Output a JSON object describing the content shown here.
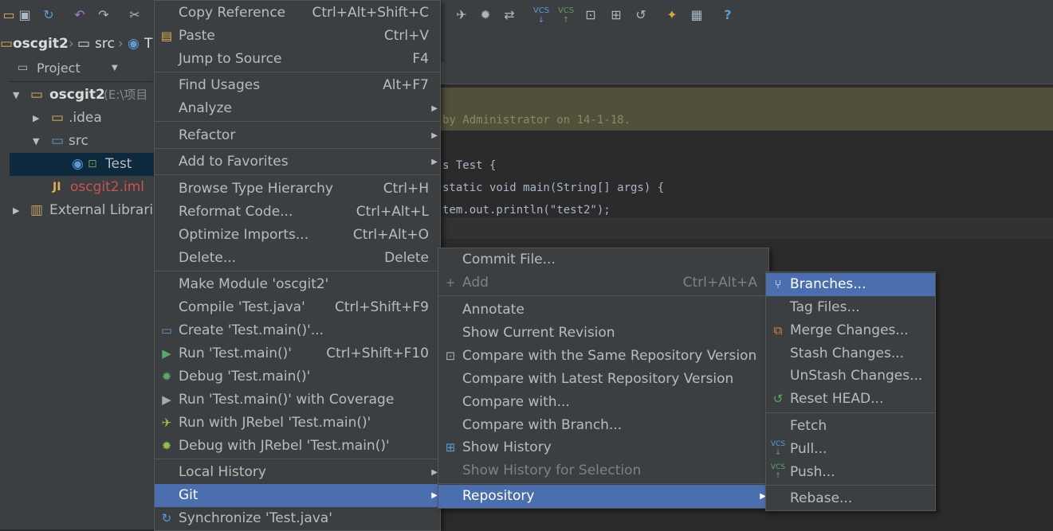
{
  "toolbar": {
    "icons": [
      "open-icon",
      "save-icon",
      "sync-icon",
      "undo-icon",
      "redo-icon",
      "cut-icon",
      "jrebel-run-icon",
      "jrebel-debug-icon",
      "vcs-update-icon",
      "vcs-update-project-icon",
      "vcs-commit-icon",
      "vcs-compare-icon",
      "vcs-history-icon",
      "vcs-revert-icon",
      "settings-icon",
      "structure-icon",
      "help-icon"
    ],
    "vcs_label": "VCS",
    "help_label": "?"
  },
  "breadcrumb": {
    "project": "oscgit2",
    "folder": "src",
    "file": "T"
  },
  "project_panel": {
    "header": "Project",
    "rows": [
      {
        "label": "oscgit2",
        "suffix": "(E:\\项目"
      },
      {
        "label": ".idea"
      },
      {
        "label": "src"
      },
      {
        "label": "Test"
      },
      {
        "label": "oscgit2.iml"
      },
      {
        "label": "External Librarie"
      }
    ]
  },
  "editor": {
    "comment": "by Administrator on 14-1-18.",
    "line1": "s Test {",
    "line2": "static void main(String[] args) {",
    "line3": "tem.out.println(\"test2\");"
  },
  "context_menu": {
    "items": [
      {
        "label": "Copy Reference",
        "shortcut": "Ctrl+Alt+Shift+C"
      },
      {
        "label": "Paste",
        "shortcut": "Ctrl+V"
      },
      {
        "label": "Jump to Source",
        "shortcut": "F4"
      },
      {
        "label": "Find Usages",
        "shortcut": "Alt+F7"
      },
      {
        "label": "Analyze"
      },
      {
        "label": "Refactor"
      },
      {
        "label": "Add to Favorites"
      },
      {
        "label": "Browse Type Hierarchy",
        "shortcut": "Ctrl+H"
      },
      {
        "label": "Reformat Code...",
        "shortcut": "Ctrl+Alt+L"
      },
      {
        "label": "Optimize Imports...",
        "shortcut": "Ctrl+Alt+O"
      },
      {
        "label": "Delete...",
        "shortcut": "Delete"
      },
      {
        "label": "Make Module 'oscgit2'"
      },
      {
        "label": "Compile 'Test.java'",
        "shortcut": "Ctrl+Shift+F9"
      },
      {
        "label": "Create 'Test.main()'..."
      },
      {
        "label": "Run 'Test.main()'",
        "shortcut": "Ctrl+Shift+F10"
      },
      {
        "label": "Debug 'Test.main()'"
      },
      {
        "label": "Run 'Test.main()' with Coverage"
      },
      {
        "label": "Run with JRebel 'Test.main()'"
      },
      {
        "label": "Debug with JRebel 'Test.main()'"
      },
      {
        "label": "Local History"
      },
      {
        "label": "Git"
      },
      {
        "label": "Synchronize 'Test.java'"
      }
    ]
  },
  "git_menu": {
    "items": [
      {
        "label": "Commit File..."
      },
      {
        "label": "Add",
        "shortcut": "Ctrl+Alt+A"
      },
      {
        "label": "Annotate"
      },
      {
        "label": "Show Current Revision"
      },
      {
        "label": "Compare with the Same Repository Version"
      },
      {
        "label": "Compare with Latest Repository Version"
      },
      {
        "label": "Compare with..."
      },
      {
        "label": "Compare with Branch..."
      },
      {
        "label": "Show History"
      },
      {
        "label": "Show History for Selection"
      },
      {
        "label": "Repository"
      }
    ]
  },
  "repository_menu": {
    "items": [
      {
        "label": "Branches..."
      },
      {
        "label": "Tag Files..."
      },
      {
        "label": "Merge Changes..."
      },
      {
        "label": "Stash Changes..."
      },
      {
        "label": "UnStash Changes..."
      },
      {
        "label": "Reset HEAD..."
      },
      {
        "label": "Fetch"
      },
      {
        "label": "Pull..."
      },
      {
        "label": "Push..."
      },
      {
        "label": "Rebase..."
      }
    ]
  },
  "colors": {
    "menu_bg": "#3c3f41",
    "highlight": "#4b6eaf",
    "text": "#bbbbbb",
    "disabled": "#808080"
  }
}
